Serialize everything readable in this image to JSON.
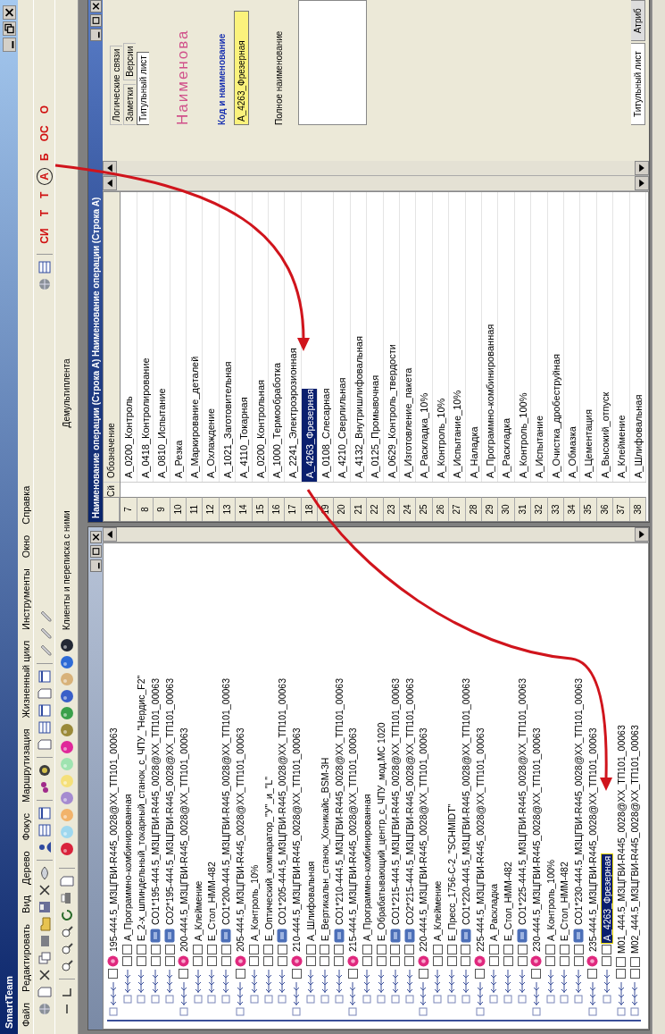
{
  "window": {
    "title": "SmartTeam"
  },
  "menu": [
    "Файл",
    "Редактировать",
    "Вид",
    "Дерево",
    "Фокус",
    "Маршрутизация",
    "Жизненный цикл",
    "Инструменты",
    "Окно",
    "Справка"
  ],
  "toolbar": {
    "letters": [
      {
        "label": "СИ",
        "circled": false
      },
      {
        "label": "Т",
        "circled": false
      },
      {
        "label": "Т",
        "circled": false
      },
      {
        "label": "А",
        "circled": true
      },
      {
        "label": "Б",
        "circled": false
      },
      {
        "label": "ОС",
        "circled": false
      },
      {
        "label": "О",
        "circled": false
      }
    ],
    "labels": [
      "Клиенты и переписка с ними",
      "Демультиплента"
    ]
  },
  "tree": {
    "items": [
      {
        "kind": "operation",
        "label": "195-444.5_М3ЦГВИ-R445_0028@ХХ_ТП101_00063",
        "selected": false,
        "children": [
          {
            "kind": "activity",
            "label": "А_Программно-комбинированная",
            "selected": false
          },
          {
            "kind": "activity",
            "label": "Е_2-х_шпиндельный_токарный_станок_с_ЧПУ_\"Нердис_F2\"",
            "selected": false
          },
          {
            "kind": "tag",
            "label": "СО1*195-444.5_М3ЦГВИ-R445_0028@ХХ_ТП101_00063",
            "selected": false
          },
          {
            "kind": "tag",
            "label": "СО2*195-444.5_М3ЦГВИ-R445_0028@ХХ_ТП101_00063",
            "selected": false
          }
        ]
      },
      {
        "kind": "operation",
        "label": "200-444.5_М3ЦГВИ-R445_0028@ХХ_ТП101_00063",
        "selected": false,
        "children": [
          {
            "kind": "activity",
            "label": "А_Клеймение",
            "selected": false
          },
          {
            "kind": "activity",
            "label": "Е_Стол_НММ-482",
            "selected": false
          },
          {
            "kind": "tag",
            "label": "СО1*200-444.5_М3ЦГВИ-R445_0028@ХХ_ТП101_00063",
            "selected": false
          }
        ]
      },
      {
        "kind": "operation",
        "label": "205-444.5_М3ЦГВИ-R445_0028@ХХ_ТП101_00063",
        "selected": false,
        "children": [
          {
            "kind": "activity",
            "label": "А_Контроль_10%",
            "selected": false
          },
          {
            "kind": "activity",
            "label": "Е_Оптический_компаратор_\"У\"_и_\"L\"",
            "selected": false
          },
          {
            "kind": "tag",
            "label": "СО1*205-444.5_М3ЦГВИ-R445_0028@ХХ_ТП101_00063",
            "selected": false
          }
        ]
      },
      {
        "kind": "operation",
        "label": "210-444.5_М3ЦГВИ-R445_0028@ХХ_ТП101_00063",
        "selected": false,
        "children": [
          {
            "kind": "activity",
            "label": "А_Шлифовальная",
            "selected": false
          },
          {
            "kind": "activity",
            "label": "Е_Вертикальн_станок_Хоникайс_BSM-3H",
            "selected": false
          },
          {
            "kind": "tag",
            "label": "СО1*210-444.5_М3ЦГВИ-R445_0028@ХХ_ТП101_00063",
            "selected": false
          }
        ]
      },
      {
        "kind": "operation",
        "label": "215-444.5_М3ЦГВИ-R445_0028@ХХ_ТП101_00063",
        "selected": false,
        "children": [
          {
            "kind": "activity",
            "label": "А_Программно-комбинированная",
            "selected": false
          },
          {
            "kind": "activity",
            "label": "Е_Обрабатывающий_центр_с_ЧПУ_мод.МС 1020",
            "selected": false
          },
          {
            "kind": "tag",
            "label": "СО1*215-444.5_М3ЦГВИ-R445_0028@ХХ_ТП101_00063",
            "selected": false
          },
          {
            "kind": "tag",
            "label": "СО2*215-444.5_М3ЦГВИ-R445_0028@ХХ_ТП101_00063",
            "selected": false
          }
        ]
      },
      {
        "kind": "operation",
        "label": "220-444.5_М3ЦГВИ-R445_0028@ХХ_ТП101_00063",
        "selected": false,
        "children": [
          {
            "kind": "activity",
            "label": "А_Клеймение",
            "selected": false
          },
          {
            "kind": "activity",
            "label": "Е_Пресс_1756-С-2_\"SCHMIDT\"",
            "selected": false
          },
          {
            "kind": "tag",
            "label": "СО1*220-444.5_М3ЦГВИ-R445_0028@ХХ_ТП101_00063",
            "selected": false
          }
        ]
      },
      {
        "kind": "operation",
        "label": "225-444.5_М3ЦГВИ-R445_0028@ХХ_ТП101_00063",
        "selected": false,
        "children": [
          {
            "kind": "activity",
            "label": "А_Раскладка",
            "selected": false
          },
          {
            "kind": "activity",
            "label": "Е_Стол_НММ-482",
            "selected": false
          },
          {
            "kind": "tag",
            "label": "СО1*225-444.5_М3ЦГВИ-R445_0028@ХХ_ТП101_00063",
            "selected": false
          }
        ]
      },
      {
        "kind": "operation",
        "label": "230-444.5_М3ЦГВИ-R445_0028@ХХ_ТП101_00063",
        "selected": false,
        "children": [
          {
            "kind": "activity",
            "label": "А_Контроль_100%",
            "selected": false
          },
          {
            "kind": "activity",
            "label": "Е_Стол_НММ-482",
            "selected": false
          },
          {
            "kind": "tag",
            "label": "СО1*230-444.5_М3ЦГВИ-R445_0028@ХХ_ТП101_00063",
            "selected": false
          }
        ]
      },
      {
        "kind": "operation",
        "label": "235-444.5_М3ЦГВИ-R445_0028@ХХ_ТП101_00063",
        "selected": false,
        "children": [
          {
            "kind": "activity",
            "label": "А_4263_Фрезерная",
            "selected": true
          }
        ]
      },
      {
        "kind": "document",
        "label": "М01_444.5_М3ЦГВИ-R445_0028@ХХ_ТП101_00063",
        "selected": false
      },
      {
        "kind": "document",
        "label": "М02_444.5_М3ЦГВИ-R445_0028@ХХ_ТП101_00063",
        "selected": false
      }
    ]
  },
  "operations_window": {
    "title": "Наименование операции (Строка А) Наименование операции (Строка А)",
    "columns": [
      "Сй",
      "Обозначение"
    ],
    "rows": [
      {
        "number": "7",
        "name": "А_0200_Контроль",
        "selected": false
      },
      {
        "number": "8",
        "name": "А_0418_Контролирование",
        "selected": false
      },
      {
        "number": "9",
        "name": "А_0810_Испытание",
        "selected": false
      },
      {
        "number": "10",
        "name": "А_Резка",
        "selected": false
      },
      {
        "number": "11",
        "name": "А_Маркирование_деталей",
        "selected": false
      },
      {
        "number": "12",
        "name": "А_Охлаждение",
        "selected": false
      },
      {
        "number": "13",
        "name": "А_1021_Заготовительная",
        "selected": false
      },
      {
        "number": "14",
        "name": "А_4110_Токарная",
        "selected": false
      },
      {
        "number": "15",
        "name": "А_0200_Контрольная",
        "selected": false
      },
      {
        "number": "16",
        "name": "А_1000_Термообработка",
        "selected": false
      },
      {
        "number": "17",
        "name": "А_2241_Электроэрозионная",
        "selected": false
      },
      {
        "number": "18",
        "name": "А_4263_Фрезерная",
        "selected": true
      },
      {
        "number": "19",
        "name": "А_0108_Слесарная",
        "selected": false
      },
      {
        "number": "20",
        "name": "А_4210_Сверлильная",
        "selected": false
      },
      {
        "number": "21",
        "name": "А_4132_Внутришлифовальная",
        "selected": false
      },
      {
        "number": "22",
        "name": "А_0125_Промывочная",
        "selected": false
      },
      {
        "number": "23",
        "name": "А_0629_Контроль_твердости",
        "selected": false
      },
      {
        "number": "24",
        "name": "А_Изготовление_пакета",
        "selected": false
      },
      {
        "number": "25",
        "name": "А_Раскладка_10%",
        "selected": false
      },
      {
        "number": "26",
        "name": "А_Контроль_10%",
        "selected": false
      },
      {
        "number": "27",
        "name": "А_Испытание_10%",
        "selected": false
      },
      {
        "number": "28",
        "name": "А_Наладка",
        "selected": false
      },
      {
        "number": "29",
        "name": "А_Программно-комбинированная",
        "selected": false
      },
      {
        "number": "30",
        "name": "А_Раскладка",
        "selected": false
      },
      {
        "number": "31",
        "name": "А_Контроль_100%",
        "selected": false
      },
      {
        "number": "32",
        "name": "А_Испытание",
        "selected": false
      },
      {
        "number": "33",
        "name": "А_Очистка_дробеструйная",
        "selected": false
      },
      {
        "number": "34",
        "name": "А_Обмазка",
        "selected": false
      },
      {
        "number": "35",
        "name": "А_Цементация",
        "selected": false
      },
      {
        "number": "36",
        "name": "А_Высокий_отпуск",
        "selected": false
      },
      {
        "number": "37",
        "name": "А_Клеймение",
        "selected": false
      },
      {
        "number": "38",
        "name": "А_Шлифовальная",
        "selected": false
      }
    ]
  },
  "properties": {
    "tabs": [
      {
        "label": "Логические связи",
        "selected": false
      },
      {
        "label": "Заметки",
        "selected": false
      },
      {
        "label": "Версии",
        "selected": false
      },
      {
        "label": "Титульный лист",
        "selected": true
      }
    ],
    "heading": "Наименова",
    "code_label": "Код и наименование",
    "code_value": "А_4263_Фрезерная",
    "full_name_label": "Полное наименование",
    "bottom_tabs": [
      {
        "label": "Титульный лист",
        "selected": true
      },
      {
        "label": "Атриб",
        "selected": false
      }
    ]
  }
}
